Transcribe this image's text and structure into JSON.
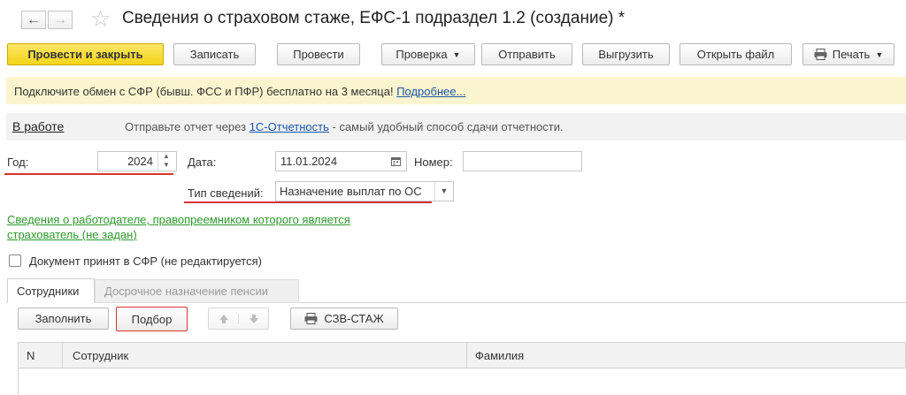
{
  "window": {
    "title": "Сведения о страховом стаже, ЕФС-1 подраздел 1.2 (создание) *",
    "back_glyph": "←",
    "forward_glyph": "→",
    "star_glyph": "☆"
  },
  "toolbar": {
    "post_close": "Провести и закрыть",
    "save": "Записать",
    "post": "Провести",
    "check": "Проверка",
    "send": "Отправить",
    "export": "Выгрузить",
    "open_file": "Открыть файл",
    "print": "Печать"
  },
  "banner": {
    "text": "Подключите обмен с СФР (бывш. ФСС и ПФР) бесплатно на 3 месяца!",
    "link": "Подробнее..."
  },
  "status": {
    "state": "В работе",
    "hint_before": "Отправьте отчет через",
    "hint_link": "1С-Отчетность",
    "hint_after": "- самый удобный способ сдачи отчетности."
  },
  "form": {
    "year_label": "Год:",
    "year_value": "2024",
    "date_label": "Дата:",
    "date_value": "11.01.2024",
    "number_label": "Номер:",
    "number_value": "",
    "type_label": "Тип сведений:",
    "type_value": "Назначение выплат по ОС",
    "employer_link_line1": "Сведения о работодателе, правопреемником которого является",
    "employer_link_line2": "страхователь (не задан)",
    "accepted_label": "Документ принят в СФР (не редактируется)",
    "accepted_checked": false
  },
  "tabs": [
    {
      "label": "Сотрудники",
      "active": true
    },
    {
      "label": "Досрочное назначение пенсии",
      "active": false
    }
  ],
  "table_toolbar": {
    "fill": "Заполнить",
    "select": "Подбор",
    "szv": "СЗВ-СТАЖ"
  },
  "table": {
    "columns": [
      "N",
      "Сотрудник",
      "Фамилия"
    ],
    "rows": []
  },
  "colors": {
    "primary": "#f4d419",
    "banner": "#fbf5cf",
    "highlight": "#d7332e",
    "link": "#1a55a8",
    "green_link": "#2b9a2b"
  }
}
